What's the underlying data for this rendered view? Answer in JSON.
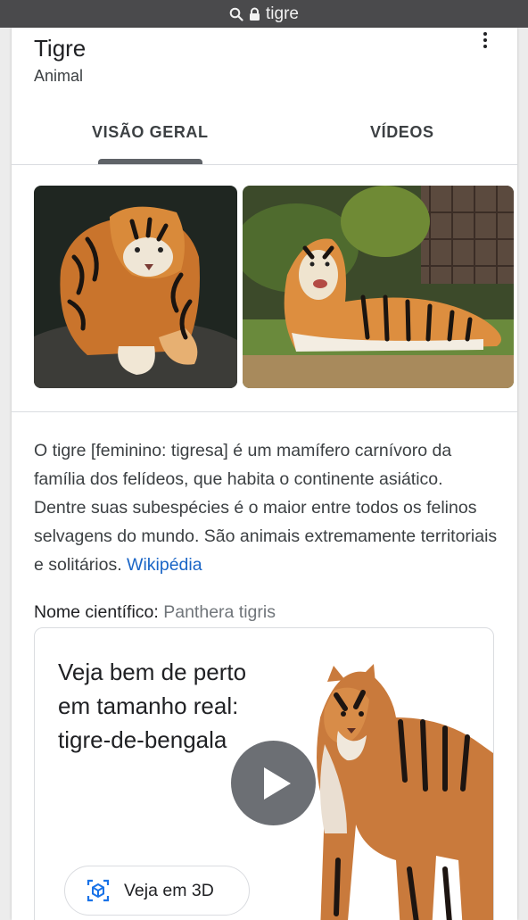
{
  "browser": {
    "url": "tigre"
  },
  "entity": {
    "title": "Tigre",
    "subtitle": "Animal"
  },
  "tabs": [
    {
      "label": "VISÃO GERAL",
      "selected": true
    },
    {
      "label": "VÍDEOS",
      "selected": false
    }
  ],
  "images": [
    {
      "alt": "tiger-lying-on-rock"
    },
    {
      "alt": "tiger-lying-on-grass"
    }
  ],
  "description": {
    "text": "O tigre [feminino: tigresa] é um mamífero carnívoro da família dos felídeos, que habita o continente asiático. Dentre suas subespécies é o maior entre todos os felinos selvagens do mundo. São animais extremamente territoriais e solitários.",
    "source_link": "Wikipédia"
  },
  "scientific_name": {
    "label": "Nome científico:",
    "value": "Panthera tigris"
  },
  "ar_card": {
    "heading": "Veja bem de perto em tamanho real: tigre-de-bengala",
    "button_label": "Veja em 3D"
  },
  "colors": {
    "link": "#1a65c6",
    "urlbar": "#4a4a4c",
    "tab_indicator": "#5f6368"
  }
}
